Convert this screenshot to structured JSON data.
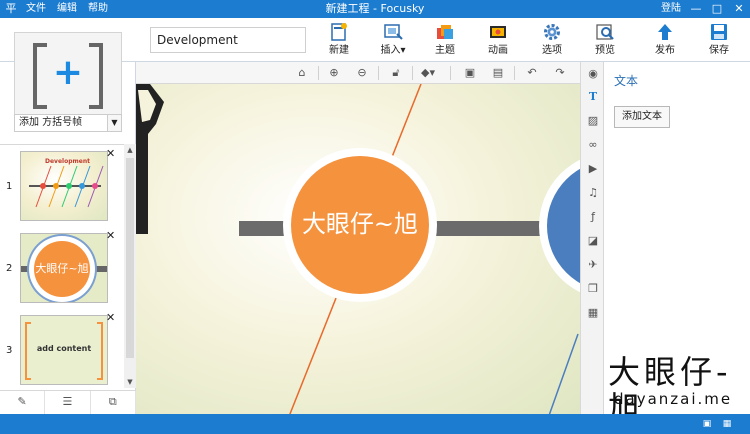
{
  "titlebar": {
    "app_icon": "平",
    "menu": [
      "文件",
      "编辑",
      "帮助"
    ],
    "title": "新建工程 - Focusky",
    "login": "登陆",
    "minimize": "—",
    "maximize": "□",
    "close": "✕"
  },
  "toolbar": {
    "project_title_value": "Development",
    "buttons": [
      {
        "label": "新建",
        "icon": "new-doc-icon"
      },
      {
        "label": "插入",
        "icon": "insert-icon"
      },
      {
        "label": "主题",
        "icon": "theme-icon"
      },
      {
        "label": "动画",
        "icon": "animation-icon"
      },
      {
        "label": "选项",
        "icon": "gear-icon"
      },
      {
        "label": "预览",
        "icon": "preview-icon"
      },
      {
        "label": "发布",
        "icon": "publish-icon"
      },
      {
        "label": "保存",
        "icon": "save-icon"
      }
    ]
  },
  "leftpanel": {
    "add_frame_plus": "+",
    "frame_type_value": "添加 方括号帧",
    "thumbnails": [
      {
        "number": "1",
        "caption": "Development"
      },
      {
        "number": "2",
        "caption": "大眼仔~旭"
      },
      {
        "number": "3",
        "caption": "add content"
      }
    ],
    "close_glyph": "✕",
    "bottom_icons": [
      "edit-frame-icon",
      "frame-list-icon",
      "frame-settings-icon"
    ]
  },
  "canvas": {
    "main_circle_text": "大眼仔~旭",
    "main_circle_color": "#f5923e",
    "side_circle_color": "#4a7ebf",
    "connector_color": "#6b6b6b"
  },
  "rail_icons": [
    "shape-icon",
    "text-icon",
    "image-icon",
    "link-icon",
    "video-icon",
    "music-icon",
    "flash-icon",
    "slides-icon",
    "plane-icon",
    "layers-icon",
    "layout-icon"
  ],
  "rightpanel": {
    "title": "文本",
    "add_text_button": "添加文本"
  },
  "watermark": {
    "logo_text": "大眼仔-旭",
    "site": "dayanzai.me"
  },
  "colors": {
    "accent": "#1c7dd0"
  }
}
